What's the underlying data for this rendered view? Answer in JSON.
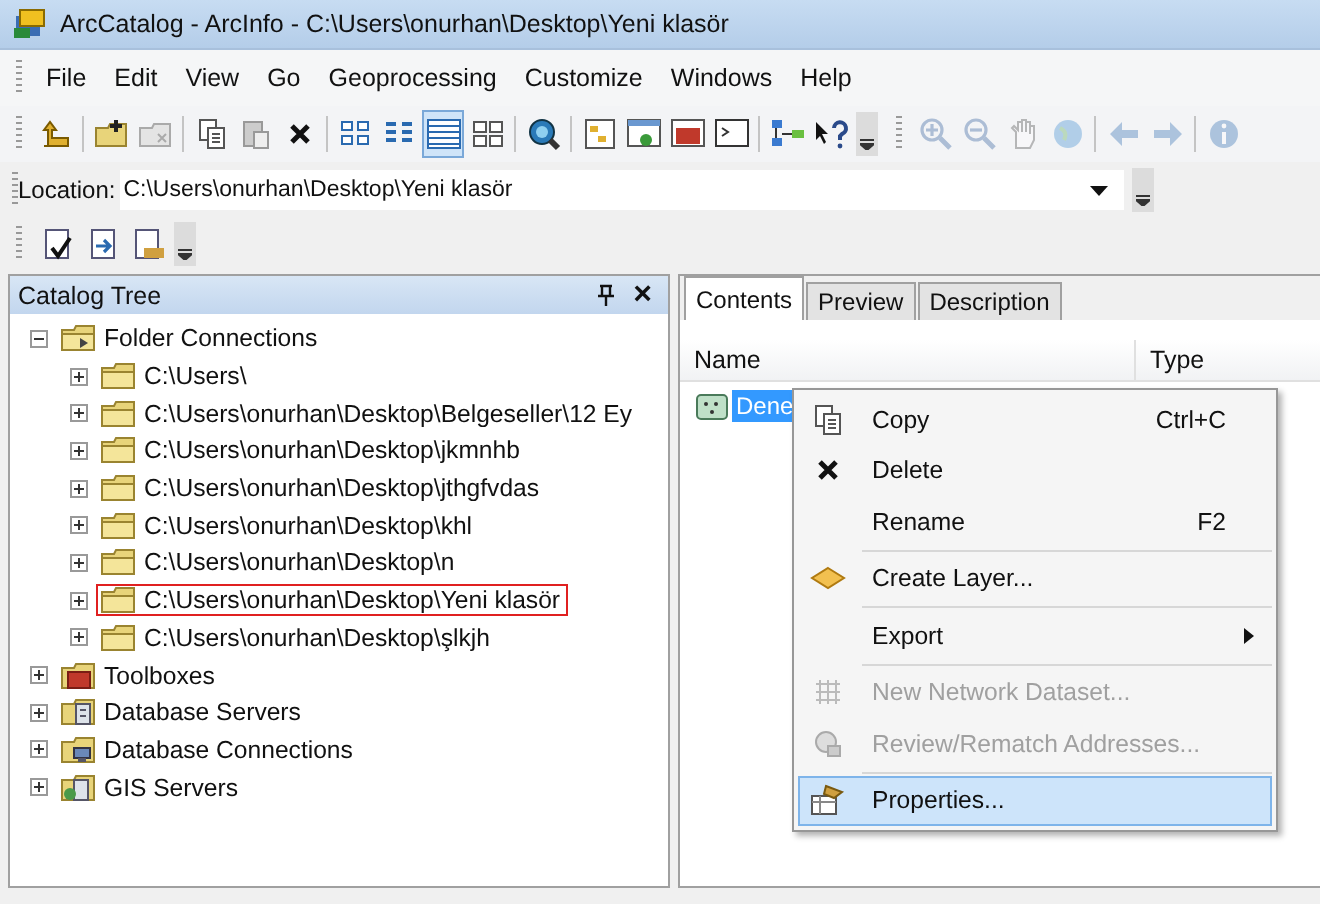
{
  "window": {
    "title": "ArcCatalog - ArcInfo - C:\\Users\\onurhan\\Desktop\\Yeni klasör"
  },
  "menu_bar": [
    "File",
    "Edit",
    "View",
    "Go",
    "Geoprocessing",
    "Customize",
    "Windows",
    "Help"
  ],
  "toolbar": {
    "view_modes": [
      {
        "selected": false
      },
      {
        "selected": false
      },
      {
        "selected": true
      },
      {
        "selected": false
      }
    ],
    "map_tools": [
      {
        "disabled": true
      },
      {
        "disabled": true
      },
      {
        "disabled": true
      },
      {
        "disabled": true
      },
      {
        "disabled": true
      },
      {
        "disabled": true
      },
      {
        "disabled": true
      }
    ]
  },
  "location": {
    "label": "Location:",
    "value": "C:\\Users\\onurhan\\Desktop\\Yeni klasör"
  },
  "catalog_tree": {
    "title": "Catalog Tree",
    "close": "×",
    "items": [
      {
        "label": "Folder Connections",
        "kind": "connections",
        "expanded": true,
        "outlined": false,
        "children": [
          {
            "label": "C:\\Users\\",
            "kind": "folder",
            "expanded": false,
            "outlined": false
          },
          {
            "label": "C:\\Users\\onurhan\\Desktop\\Belgeseller\\12 Ey",
            "kind": "folder",
            "expanded": false,
            "outlined": false
          },
          {
            "label": "C:\\Users\\onurhan\\Desktop\\jkmnhb",
            "kind": "folder",
            "expanded": false,
            "outlined": false
          },
          {
            "label": "C:\\Users\\onurhan\\Desktop\\jthgfvdas",
            "kind": "folder",
            "expanded": false,
            "outlined": false
          },
          {
            "label": "C:\\Users\\onurhan\\Desktop\\khl",
            "kind": "folder",
            "expanded": false,
            "outlined": false
          },
          {
            "label": "C:\\Users\\onurhan\\Desktop\\n",
            "kind": "folder",
            "expanded": false,
            "outlined": false
          },
          {
            "label": "C:\\Users\\onurhan\\Desktop\\Yeni klasör",
            "kind": "folder",
            "expanded": false,
            "outlined": true
          },
          {
            "label": "C:\\Users\\onurhan\\Desktop\\şlkjh",
            "kind": "folder",
            "expanded": false,
            "outlined": false
          }
        ]
      },
      {
        "label": "Toolboxes",
        "kind": "toolboxes",
        "expanded": false,
        "outlined": false
      },
      {
        "label": "Database Servers",
        "kind": "servers",
        "expanded": false,
        "outlined": false
      },
      {
        "label": "Database Connections",
        "kind": "connections-db",
        "expanded": false,
        "outlined": false
      },
      {
        "label": "GIS Servers",
        "kind": "gis",
        "expanded": false,
        "outlined": false
      }
    ]
  },
  "contents": {
    "tabs": [
      {
        "label": "Contents",
        "selected": true
      },
      {
        "label": "Preview",
        "selected": false
      },
      {
        "label": "Description",
        "selected": false
      }
    ],
    "columns": [
      "Name",
      "Type"
    ],
    "rows": [
      {
        "name": "Dene",
        "selected": true
      }
    ]
  },
  "context_menu": {
    "groups": [
      [
        {
          "label": "Copy",
          "shortcut": "Ctrl+C",
          "disabled": false,
          "selected": false,
          "submenu": false
        },
        {
          "label": "Delete",
          "disabled": false,
          "selected": false,
          "submenu": false
        },
        {
          "label": "Rename",
          "shortcut": "F2",
          "disabled": false,
          "selected": false,
          "submenu": false
        }
      ],
      [
        {
          "label": "Create Layer...",
          "disabled": false,
          "selected": false,
          "submenu": false
        }
      ],
      [
        {
          "label": "Export",
          "disabled": false,
          "selected": false,
          "submenu": true
        }
      ],
      [
        {
          "label": "New Network Dataset...",
          "disabled": true,
          "selected": false,
          "submenu": false
        },
        {
          "label": "Review/Rematch Addresses...",
          "disabled": true,
          "selected": false,
          "submenu": false
        }
      ],
      [
        {
          "label": "Properties...",
          "disabled": false,
          "selected": true,
          "submenu": false
        }
      ]
    ]
  }
}
